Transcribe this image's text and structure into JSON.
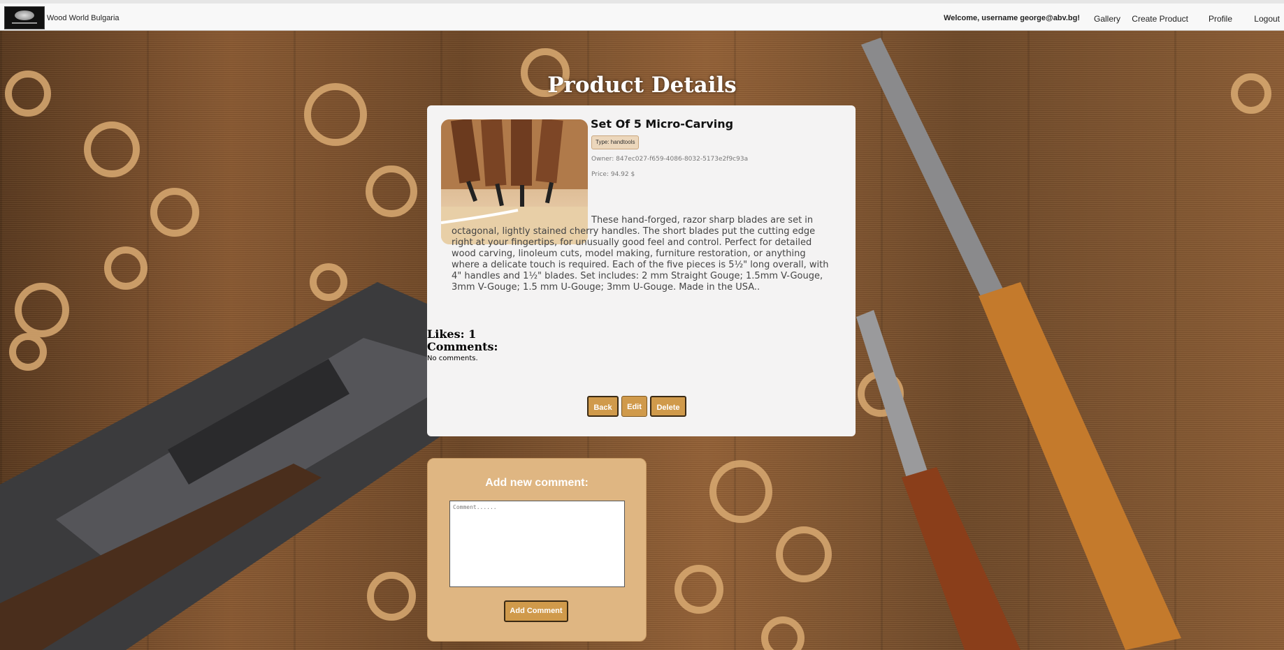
{
  "nav": {
    "brand": "Wood World Bulgaria",
    "welcome": "Welcome, username george@abv.bg!",
    "links": [
      "Gallery",
      "Create Product",
      "Profile",
      "Logout"
    ]
  },
  "page": {
    "title": "Product Details"
  },
  "product": {
    "name": "Set Of 5 Micro-Carving",
    "type": "Type: handtools",
    "owner": "Owner: 847ec027-f659-4086-8032-5173e2f9c93a",
    "price": "Price: 94.92 $",
    "description": "These hand-forged, razor sharp blades are set in octagonal, lightly stained cherry handles. The short blades put the cutting edge right at your fingertips, for unusually good feel and control. Perfect for detailed wood carving, linoleum cuts, model making, furniture restoration, or anything where a delicate touch is required. Each of the five pieces is 5½\" long overall, with 4\" handles and 1½\" blades. Set includes: 2 mm Straight Gouge; 1.5mm V-Gouge, 3mm V-Gouge; 1.5 mm U-Gouge; 3mm U-Gouge. Made in the USA..",
    "likes": "Likes: 1",
    "comments_heading": "Comments:",
    "no_comments": "No comments."
  },
  "actions": {
    "back": "Back",
    "edit": "Edit",
    "delete": "Delete"
  },
  "comment_form": {
    "title": "Add new comment:",
    "placeholder": "Comment......",
    "value": "",
    "submit": "Add Comment"
  },
  "colors": {
    "accent": "#d09a4b",
    "comment_card": "#dfb682",
    "card": "#f4f3f3"
  }
}
